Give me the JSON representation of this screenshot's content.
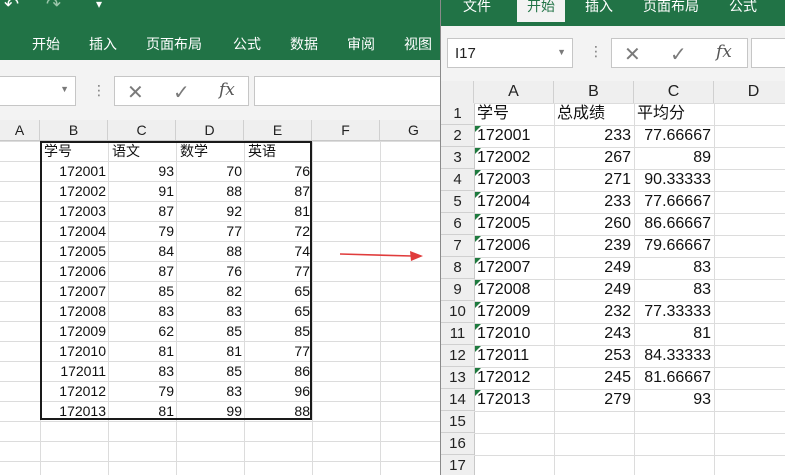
{
  "left": {
    "qat": {
      "undo": "↶",
      "redo": "↷",
      "customize": "▾"
    },
    "ribbon_tabs": [
      "开始",
      "插入",
      "页面布局",
      "公式",
      "数据",
      "审阅",
      "视图"
    ],
    "fx": "fx",
    "columns": [
      "A",
      "B",
      "C",
      "D",
      "E",
      "F",
      "G"
    ],
    "headers": [
      "学号",
      "语文",
      "数学",
      "英语"
    ],
    "rows": [
      [
        "172001",
        "93",
        "70",
        "76"
      ],
      [
        "172002",
        "91",
        "88",
        "87"
      ],
      [
        "172003",
        "87",
        "92",
        "81"
      ],
      [
        "172004",
        "79",
        "77",
        "72"
      ],
      [
        "172005",
        "84",
        "88",
        "74"
      ],
      [
        "172006",
        "87",
        "76",
        "77"
      ],
      [
        "172007",
        "85",
        "82",
        "65"
      ],
      [
        "172008",
        "83",
        "83",
        "65"
      ],
      [
        "172009",
        "62",
        "85",
        "85"
      ],
      [
        "172010",
        "81",
        "81",
        "77"
      ],
      [
        "172011",
        "83",
        "85",
        "86"
      ],
      [
        "172012",
        "79",
        "83",
        "96"
      ],
      [
        "172013",
        "81",
        "99",
        "88"
      ]
    ]
  },
  "right": {
    "ribbon_tabs": [
      "文件",
      "开始",
      "插入",
      "页面布局",
      "公式"
    ],
    "active_tab": "开始",
    "name_box": "I17",
    "fx": "fx",
    "columns": [
      "A",
      "B",
      "C",
      "D"
    ],
    "row_numbers": [
      "1",
      "2",
      "3",
      "4",
      "5",
      "6",
      "7",
      "8",
      "9",
      "10",
      "11",
      "12",
      "13",
      "14",
      "15",
      "16",
      "17"
    ],
    "headers": [
      "学号",
      "总成绩",
      "平均分"
    ],
    "rows": [
      [
        "172001",
        "233",
        "77.66667"
      ],
      [
        "172002",
        "267",
        "89"
      ],
      [
        "172003",
        "271",
        "90.33333"
      ],
      [
        "172004",
        "233",
        "77.66667"
      ],
      [
        "172005",
        "260",
        "86.66667"
      ],
      [
        "172006",
        "239",
        "79.66667"
      ],
      [
        "172007",
        "249",
        "83"
      ],
      [
        "172008",
        "249",
        "83"
      ],
      [
        "172009",
        "232",
        "77.33333"
      ],
      [
        "172010",
        "243",
        "81"
      ],
      [
        "172011",
        "253",
        "84.33333"
      ],
      [
        "172012",
        "245",
        "81.66667"
      ],
      [
        "172013",
        "279",
        "93"
      ]
    ]
  },
  "colors": {
    "ribbon": "#217346",
    "arrow": "#e03c3c",
    "grid": "#dcdcdc",
    "indicator": "#1e7a3e"
  }
}
